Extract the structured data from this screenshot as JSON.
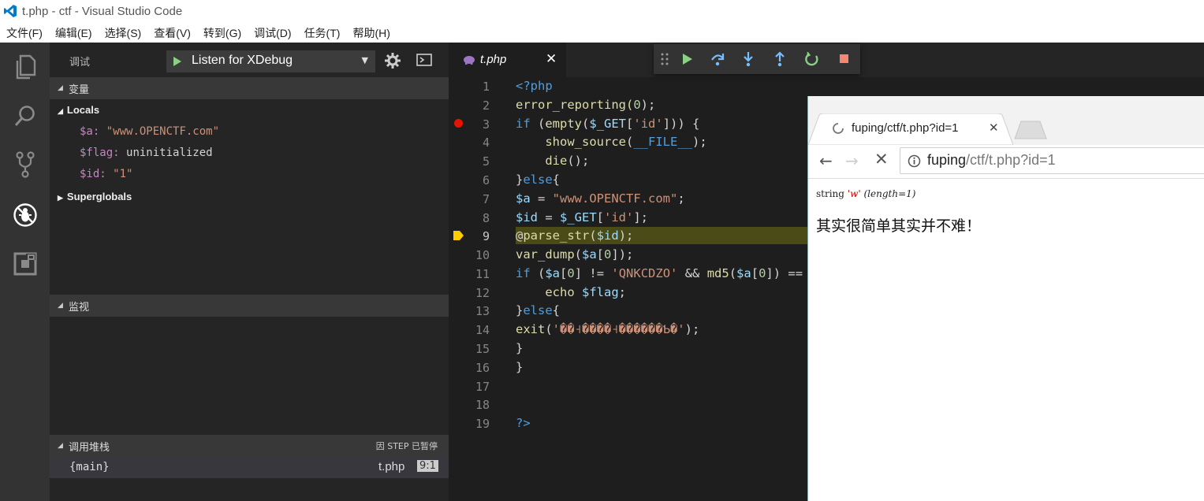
{
  "window": {
    "title": "t.php - ctf - Visual Studio Code"
  },
  "menu": [
    "文件(F)",
    "编辑(E)",
    "选择(S)",
    "查看(V)",
    "转到(G)",
    "调试(D)",
    "任务(T)",
    "帮助(H)"
  ],
  "activity_icons": [
    "explorer-icon",
    "search-icon",
    "source-control-icon",
    "debug-icon",
    "extensions-icon"
  ],
  "debug": {
    "label": "调试",
    "config": "Listen for XDebug",
    "sections": {
      "variables": "变量",
      "watch": "监视",
      "callstack": "调用堆栈",
      "callstack_status": "因 STEP 已暂停"
    },
    "locals_label": "Locals",
    "superglobals_label": "Superglobals",
    "variables": [
      {
        "name": "$a:",
        "value": "\"www.OPENCTF.com\""
      },
      {
        "name": "$flag:",
        "value": "uninitialized"
      },
      {
        "name": "$id:",
        "value": "\"1\""
      }
    ],
    "stack": {
      "frame": "{main}",
      "file": "t.php",
      "pos": "9:1"
    }
  },
  "editor": {
    "tab_label": "t.php",
    "line_numbers": [
      "1",
      "2",
      "3",
      "4",
      "5",
      "6",
      "7",
      "8",
      "9",
      "10",
      "11",
      "12",
      "13",
      "14",
      "15",
      "16",
      "17",
      "18",
      "19"
    ],
    "code": {
      "l1": "<?php",
      "l2a": "error_reporting(",
      "l2b": "0",
      "l2c": ");",
      "l3a": "if",
      "l3b": " (",
      "l3c": "empty",
      "l3d": "(",
      "l3e": "$_GET",
      "l3f": "[",
      "l3g": "'id'",
      "l3h": "])) {",
      "l4a": "    ",
      "l4b": "show_source",
      "l4c": "(",
      "l4d": "__FILE__",
      "l4e": ");",
      "l5a": "    ",
      "l5b": "die",
      "l5c": "();",
      "l6a": "}",
      "l6b": "else",
      "l6c": "{",
      "l7a": "$a",
      "l7b": " = ",
      "l7c": "\"www.OPENCTF.com\"",
      "l7d": ";",
      "l8a": "$id",
      "l8b": " = ",
      "l8c": "$_GET",
      "l8d": "[",
      "l8e": "'id'",
      "l8f": "];",
      "l9a": "@",
      "l9b": "parse_str",
      "l9c": "(",
      "l9d": "$id",
      "l9e": ");",
      "l10a": "var_dump",
      "l10b": "(",
      "l10c": "$a",
      "l10d": "[",
      "l10e": "0",
      "l10f": "]);",
      "l11a": "if",
      "l11b": " (",
      "l11c": "$a",
      "l11d": "[",
      "l11e": "0",
      "l11f": "] != ",
      "l11g": "'QNKCDZO'",
      "l11h": " && ",
      "l11i": "md5",
      "l11j": "(",
      "l11k": "$a",
      "l11l": "[",
      "l11m": "0",
      "l11n": "]) ==",
      "l12a": "    ",
      "l12b": "echo",
      "l12c": " ",
      "l12d": "$flag",
      "l12e": ";",
      "l13a": "}",
      "l13b": "else",
      "l13c": "{",
      "l14a": "exit",
      "l14b": "(",
      "l14c": "'��˧����˧������Ƅ�'",
      "l14d": ");",
      "l15": "}",
      "l16": "}",
      "l19": "?>"
    }
  },
  "browser": {
    "tab_title": "fuping/ctf/t.php?id=1",
    "url_host": "fuping",
    "url_path": "/ctf/t.php?id=1",
    "dump_type": "string",
    "dump_value": "'w'",
    "dump_len": "(length=1)",
    "body_text": "其实很简单其实并不难！"
  },
  "colors": {
    "accent_blue": "#007acc",
    "breakpoint": "#e51400",
    "current_line": "#ffcc00",
    "continue_green": "#89d185",
    "stop_red": "#f48771"
  }
}
